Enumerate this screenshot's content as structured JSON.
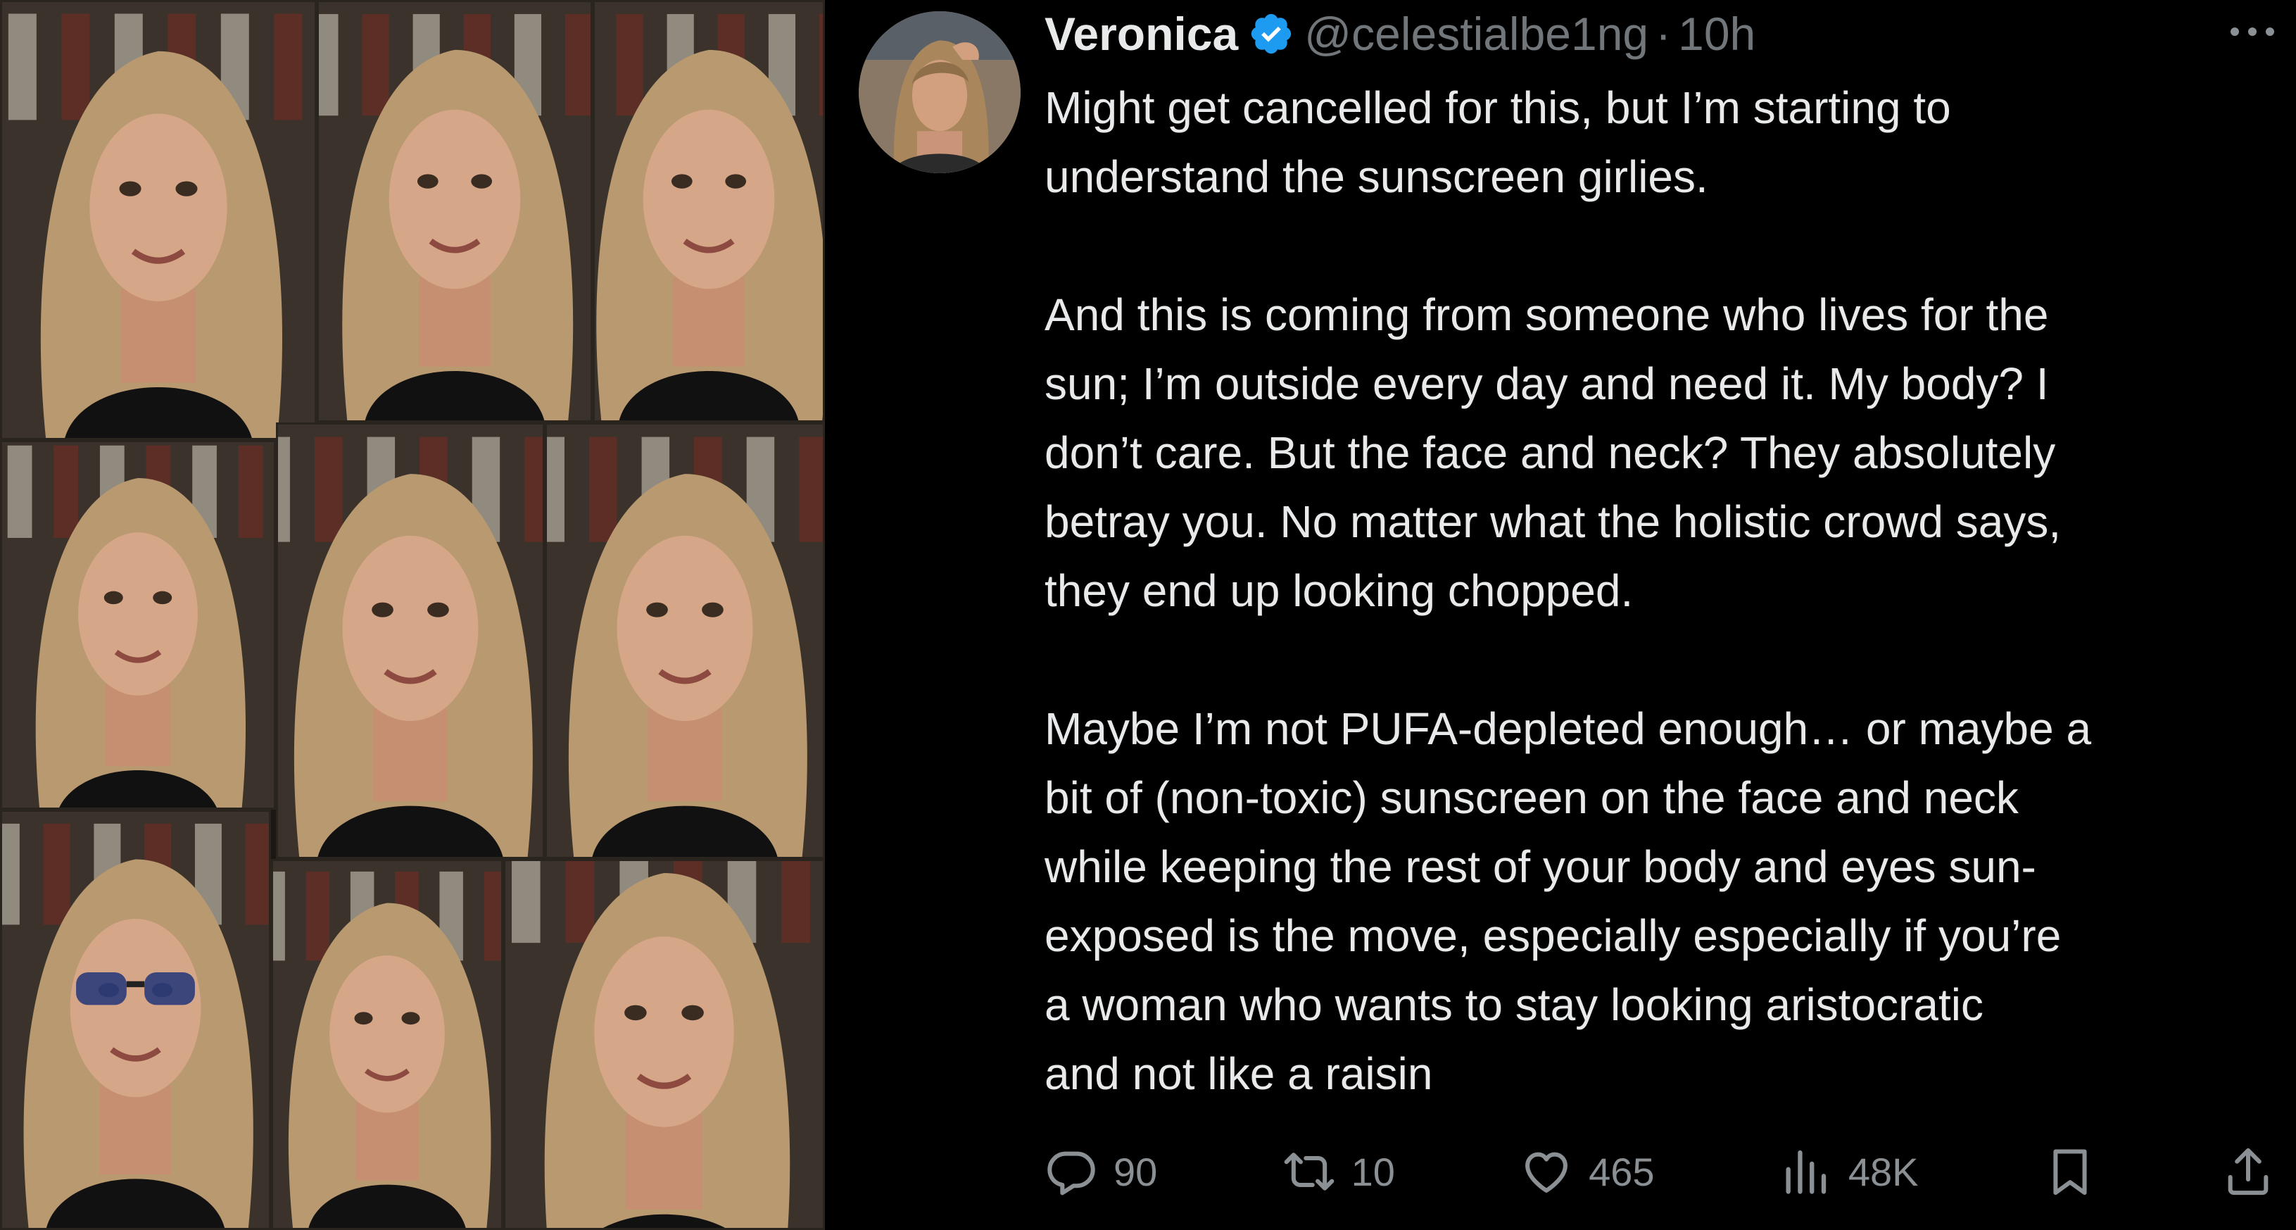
{
  "tweet": {
    "author": {
      "display_name": "Veronica",
      "handle": "@celestialbe1ng",
      "separator": "·",
      "time": "10h",
      "verified": true,
      "verified_color": "#1d9bf0"
    },
    "paragraphs": [
      [
        "Might get cancelled for this, but I’m starting to",
        "understand the sunscreen girlies."
      ],
      [
        "And this is coming from someone who lives for the",
        "sun; I’m outside every day and need it. My body? I",
        "don’t care. But the face and neck? They absolutely",
        "betray you. No matter what the holistic crowd says,",
        "they end up looking chopped."
      ],
      [
        "Maybe I’m not PUFA-depleted enough… or maybe a",
        "bit of (non-toxic) sunscreen on the face and neck",
        "while keeping the rest of your body and eyes sun-",
        "exposed is the move, especially especially if you’re",
        "a woman who wants to stay looking aristocratic",
        "and not like a raisin"
      ]
    ],
    "actions": {
      "reply_count": "90",
      "repost_count": "10",
      "like_count": "465",
      "views_count": "48K"
    },
    "icons": {
      "more": "more-horizontal-icon",
      "reply": "reply-icon",
      "repost": "repost-icon",
      "like": "heart-icon",
      "views": "views-bar-chart-icon",
      "bookmark": "bookmark-icon",
      "share": "share-icon"
    }
  },
  "collage": {
    "tile_count": 9,
    "description_colors": {
      "hair": "#b9996f",
      "skin": "#d6a688",
      "background": "#3b332b"
    }
  }
}
